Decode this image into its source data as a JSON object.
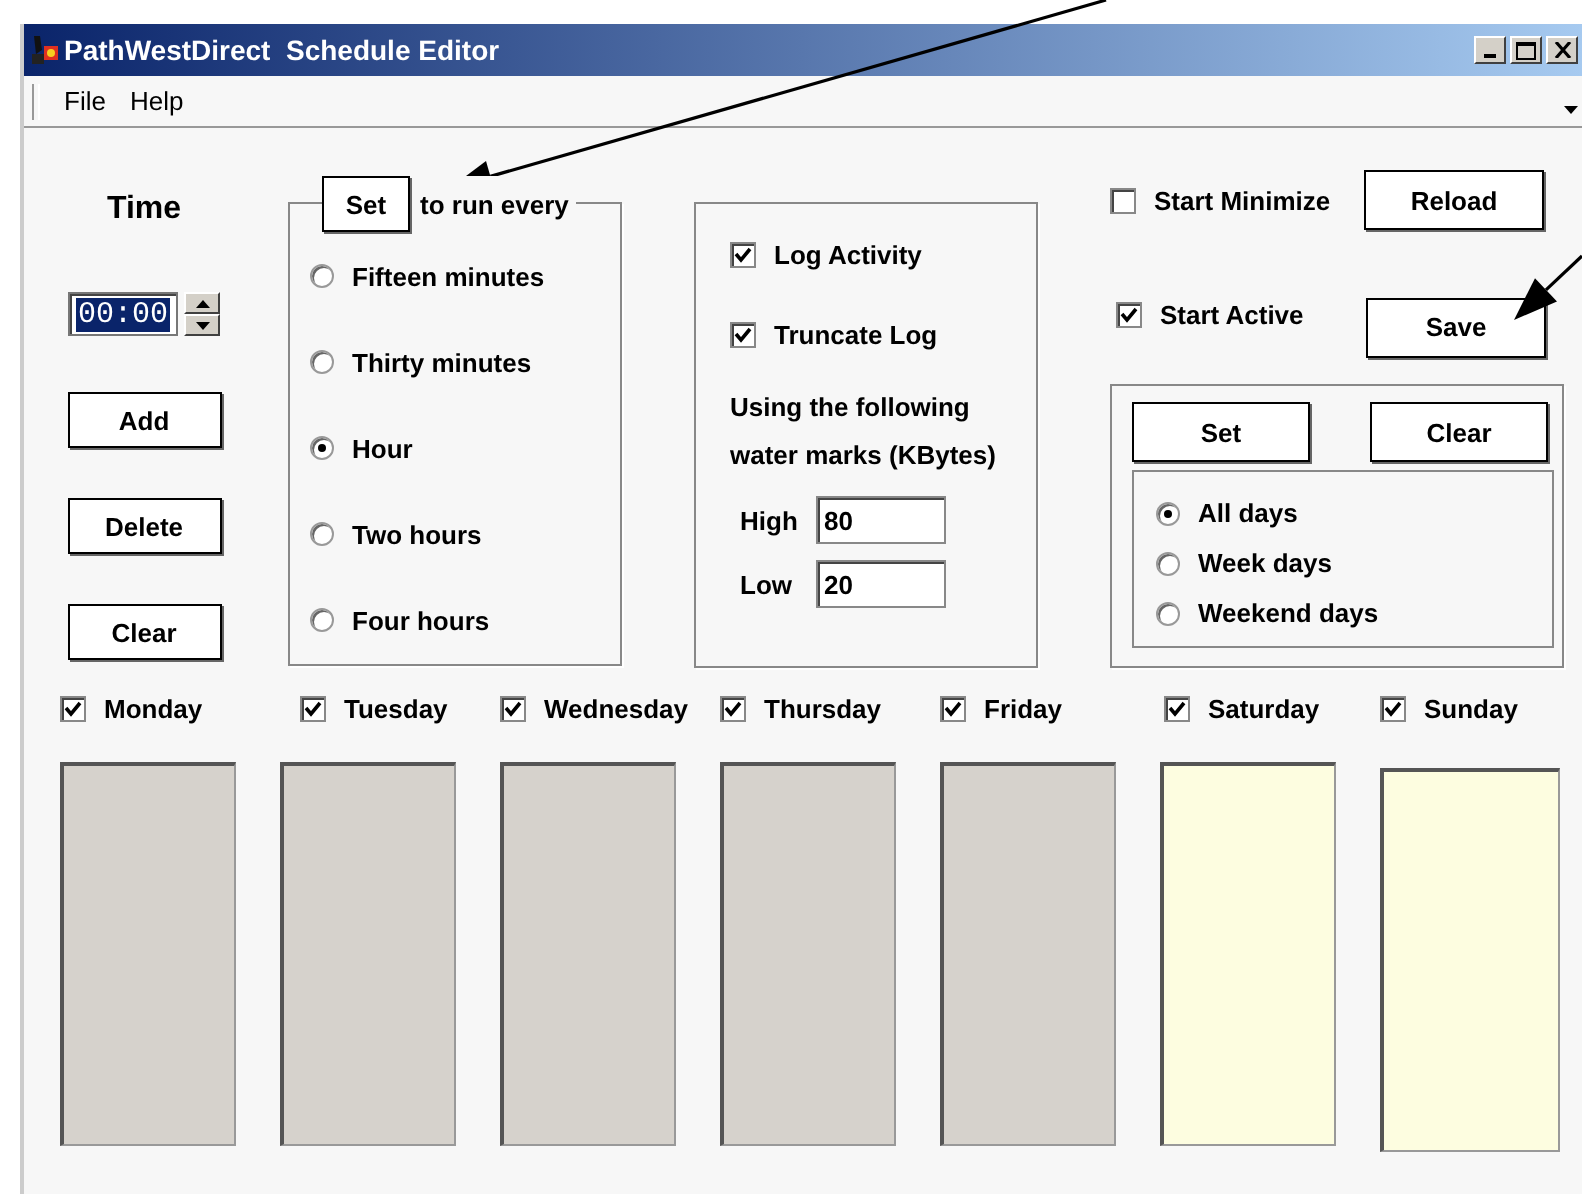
{
  "window": {
    "title": "PathWestDirect  Schedule Editor"
  },
  "menu": [
    "File",
    "Help"
  ],
  "time": {
    "label": "Time",
    "value": "00:00"
  },
  "time_buttons": [
    "Add",
    "Delete",
    "Clear"
  ],
  "interval": {
    "button": "Set",
    "label": "to run every",
    "options": [
      {
        "label": "Fifteen minutes",
        "selected": false
      },
      {
        "label": "Thirty minutes",
        "selected": false
      },
      {
        "label": "Hour",
        "selected": true
      },
      {
        "label": "Two hours",
        "selected": false
      },
      {
        "label": "Four hours",
        "selected": false
      }
    ]
  },
  "logging": {
    "options": [
      {
        "label": "Log Activity",
        "checked": true
      },
      {
        "label": "Truncate Log",
        "checked": true
      }
    ],
    "note": "Using the following water marks (KBytes)",
    "fields": [
      {
        "label": "High",
        "value": "80"
      },
      {
        "label": "Low",
        "value": "20"
      }
    ]
  },
  "startup": [
    {
      "label": "Start Minimize",
      "checked": false,
      "button": "Reload"
    },
    {
      "label": "Start Active",
      "checked": true,
      "button": "Save"
    }
  ],
  "days_panel": {
    "buttons": [
      "Set",
      "Clear"
    ],
    "options": [
      {
        "label": "All days",
        "selected": true
      },
      {
        "label": "Week days",
        "selected": false
      },
      {
        "label": "Weekend days",
        "selected": false
      }
    ]
  },
  "days": [
    {
      "label": "Monday",
      "checked": true,
      "color": "#d6d2cc"
    },
    {
      "label": "Tuesday",
      "checked": true,
      "color": "#d6d2cc"
    },
    {
      "label": "Wednesday",
      "checked": true,
      "color": "#d6d2cc"
    },
    {
      "label": "Thursday",
      "checked": true,
      "color": "#d6d2cc"
    },
    {
      "label": "Friday",
      "checked": true,
      "color": "#d6d2cc"
    },
    {
      "label": "Saturday",
      "checked": true,
      "color": "#fdfde0"
    },
    {
      "label": "Sunday",
      "checked": true,
      "color": "#fdfde0"
    }
  ]
}
